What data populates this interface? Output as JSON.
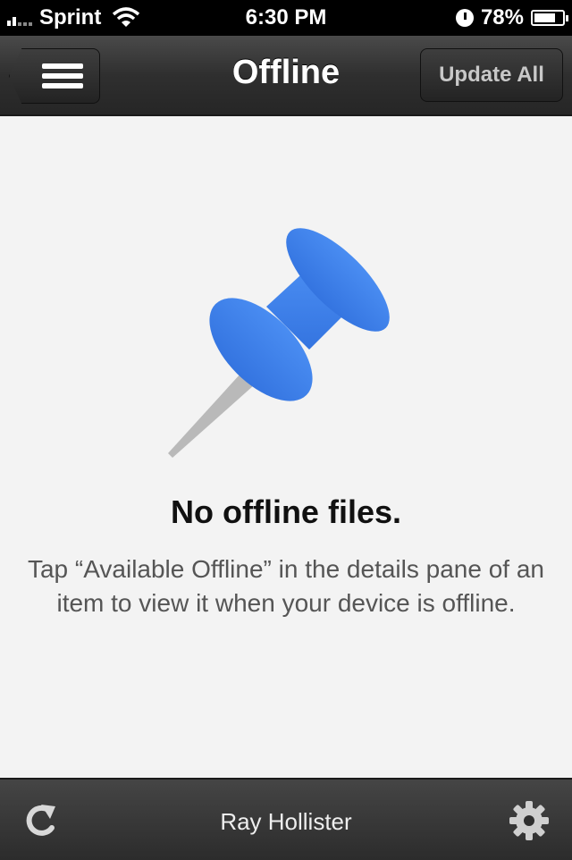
{
  "status_bar": {
    "carrier": "Sprint",
    "time": "6:30 PM",
    "battery_percent": "78%",
    "battery_level": 0.78
  },
  "nav": {
    "title": "Offline",
    "menu_icon": "hamburger-menu-icon",
    "update_all_label": "Update All"
  },
  "empty_state": {
    "icon": "pushpin-icon",
    "icon_color": "#3f80e9",
    "title": "No offline files.",
    "message": "Tap “Available Offline” in the details pane of an item to view it when your device is offline."
  },
  "toolbar": {
    "refresh_icon": "refresh-icon",
    "user_name": "Ray Hollister",
    "settings_icon": "gear-icon"
  }
}
